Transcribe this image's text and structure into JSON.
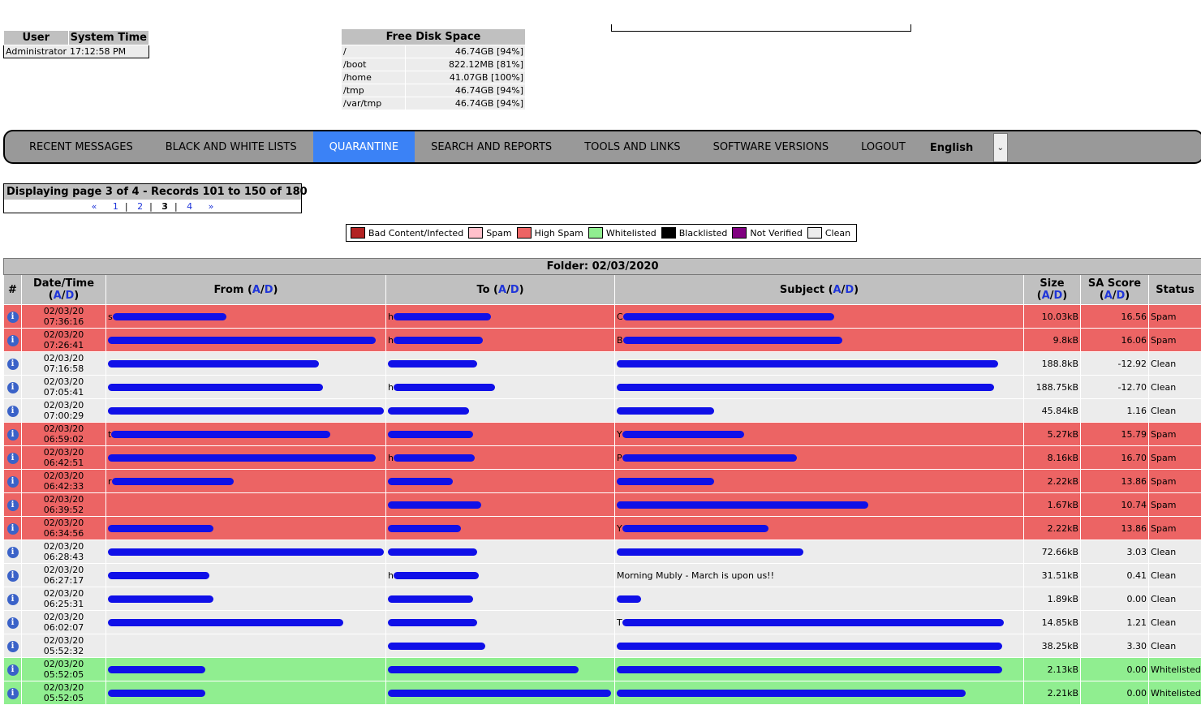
{
  "user_box": {
    "header_user": "User",
    "header_time": "System Time",
    "user": "Administrator",
    "time": "17:12:58 PM"
  },
  "disk": {
    "title": "Free Disk Space",
    "rows": [
      {
        "mount": "/",
        "value": "46.74GB [94%]"
      },
      {
        "mount": "/boot",
        "value": "822.12MB [81%]"
      },
      {
        "mount": "/home",
        "value": "41.07GB [100%]"
      },
      {
        "mount": "/tmp",
        "value": "46.74GB [94%]"
      },
      {
        "mount": "/var/tmp",
        "value": "46.74GB [94%]"
      }
    ]
  },
  "nav": {
    "items": [
      "RECENT MESSAGES",
      "BLACK AND WHITE LISTS",
      "QUARANTINE",
      "SEARCH AND REPORTS",
      "TOOLS AND LINKS",
      "SOFTWARE VERSIONS",
      "LOGOUT"
    ],
    "active_index": 2,
    "language": "English"
  },
  "pager": {
    "title": "Displaying page 3 of 4 - Records 101 to 150 of 180",
    "prev": "«",
    "next": "»",
    "pages": [
      "1",
      "2",
      "3",
      "4"
    ],
    "current": "3",
    "separator": "|"
  },
  "legend": [
    {
      "label": "Bad Content/Infected",
      "color": "#b22222"
    },
    {
      "label": "Spam",
      "color": "#ffc0cb"
    },
    {
      "label": "High Spam",
      "color": "#ec6464"
    },
    {
      "label": "Whitelisted",
      "color": "#90ee90"
    },
    {
      "label": "Blacklisted",
      "color": "#000000"
    },
    {
      "label": "Not Verified",
      "color": "#800080"
    },
    {
      "label": "Clean",
      "color": "#ececec"
    }
  ],
  "table": {
    "folder": "Folder: 02/03/2020",
    "headers": {
      "num": "#",
      "date": "Date/Time",
      "from": "From",
      "to": "To",
      "subject": "Subject",
      "size": "Size",
      "score": "SA Score",
      "status": "Status",
      "sort_a": "A",
      "sort_d": "D",
      "sort_sep": "/",
      "sort_open": "(",
      "sort_close": ")"
    },
    "rows": [
      {
        "cls": "spam",
        "date": "02/03/20",
        "time": "07:36:16",
        "from": "s",
        "to": "h",
        "subject": "C",
        "size": "10.03kB",
        "score": "16.56",
        "status": "Spam"
      },
      {
        "cls": "spam",
        "date": "02/03/20",
        "time": "07:26:41",
        "from": "",
        "to": "h",
        "subject": "B",
        "size": "9.8kB",
        "score": "16.06",
        "status": "Spam"
      },
      {
        "cls": "clean",
        "date": "02/03/20",
        "time": "07:16:58",
        "from": "",
        "to": "",
        "subject": "",
        "size": "188.8kB",
        "score": "-12.92",
        "status": "Clean"
      },
      {
        "cls": "clean",
        "date": "02/03/20",
        "time": "07:05:41",
        "from": "",
        "to": "h",
        "subject": "",
        "size": "188.75kB",
        "score": "-12.70",
        "status": "Clean"
      },
      {
        "cls": "clean",
        "date": "02/03/20",
        "time": "07:00:29",
        "from": "",
        "to": "",
        "subject": "",
        "size": "45.84kB",
        "score": "1.16",
        "status": "Clean"
      },
      {
        "cls": "spam",
        "date": "02/03/20",
        "time": "06:59:02",
        "from": "t",
        "to": "",
        "subject": "Y",
        "size": "5.27kB",
        "score": "15.79",
        "status": "Spam"
      },
      {
        "cls": "spam",
        "date": "02/03/20",
        "time": "06:42:51",
        "from": "",
        "to": "h",
        "subject": "P",
        "size": "8.16kB",
        "score": "16.70",
        "status": "Spam"
      },
      {
        "cls": "spam",
        "date": "02/03/20",
        "time": "06:42:33",
        "from": "r",
        "to": "",
        "subject": "",
        "size": "2.22kB",
        "score": "13.86",
        "status": "Spam"
      },
      {
        "cls": "spam",
        "date": "02/03/20",
        "time": "06:39:52",
        "from": "",
        "to": "",
        "subject": "",
        "size": "1.67kB",
        "score": "10.74",
        "status": "Spam"
      },
      {
        "cls": "spam",
        "date": "02/03/20",
        "time": "06:34:56",
        "from": "",
        "to": "",
        "subject": "Y",
        "size": "2.22kB",
        "score": "13.86",
        "status": "Spam"
      },
      {
        "cls": "clean",
        "date": "02/03/20",
        "time": "06:28:43",
        "from": "",
        "to": "",
        "subject": "",
        "size": "72.66kB",
        "score": "3.03",
        "status": "Clean"
      },
      {
        "cls": "clean",
        "date": "02/03/20",
        "time": "06:27:17",
        "from": "",
        "to": "h",
        "subject": "Morning Mubly - March is upon us!!",
        "size": "31.51kB",
        "score": "0.41",
        "status": "Clean"
      },
      {
        "cls": "clean",
        "date": "02/03/20",
        "time": "06:25:31",
        "from": "",
        "to": "",
        "subject": "",
        "size": "1.89kB",
        "score": "0.00",
        "status": "Clean"
      },
      {
        "cls": "clean",
        "date": "02/03/20",
        "time": "06:02:07",
        "from": "",
        "to": "",
        "subject": "T",
        "size": "14.85kB",
        "score": "1.21",
        "status": "Clean"
      },
      {
        "cls": "clean",
        "date": "02/03/20",
        "time": "05:52:32",
        "from": "",
        "to": "",
        "subject": "",
        "size": "38.25kB",
        "score": "3.30",
        "status": "Clean"
      },
      {
        "cls": "wl",
        "date": "02/03/20",
        "time": "05:52:05",
        "from": "",
        "to": "",
        "subject": "",
        "size": "2.13kB",
        "score": "0.00",
        "status": "Whitelisted"
      },
      {
        "cls": "wl",
        "date": "02/03/20",
        "time": "05:52:05",
        "from": "",
        "to": "",
        "subject": "",
        "size": "2.21kB",
        "score": "0.00",
        "status": "Whitelisted"
      }
    ]
  }
}
